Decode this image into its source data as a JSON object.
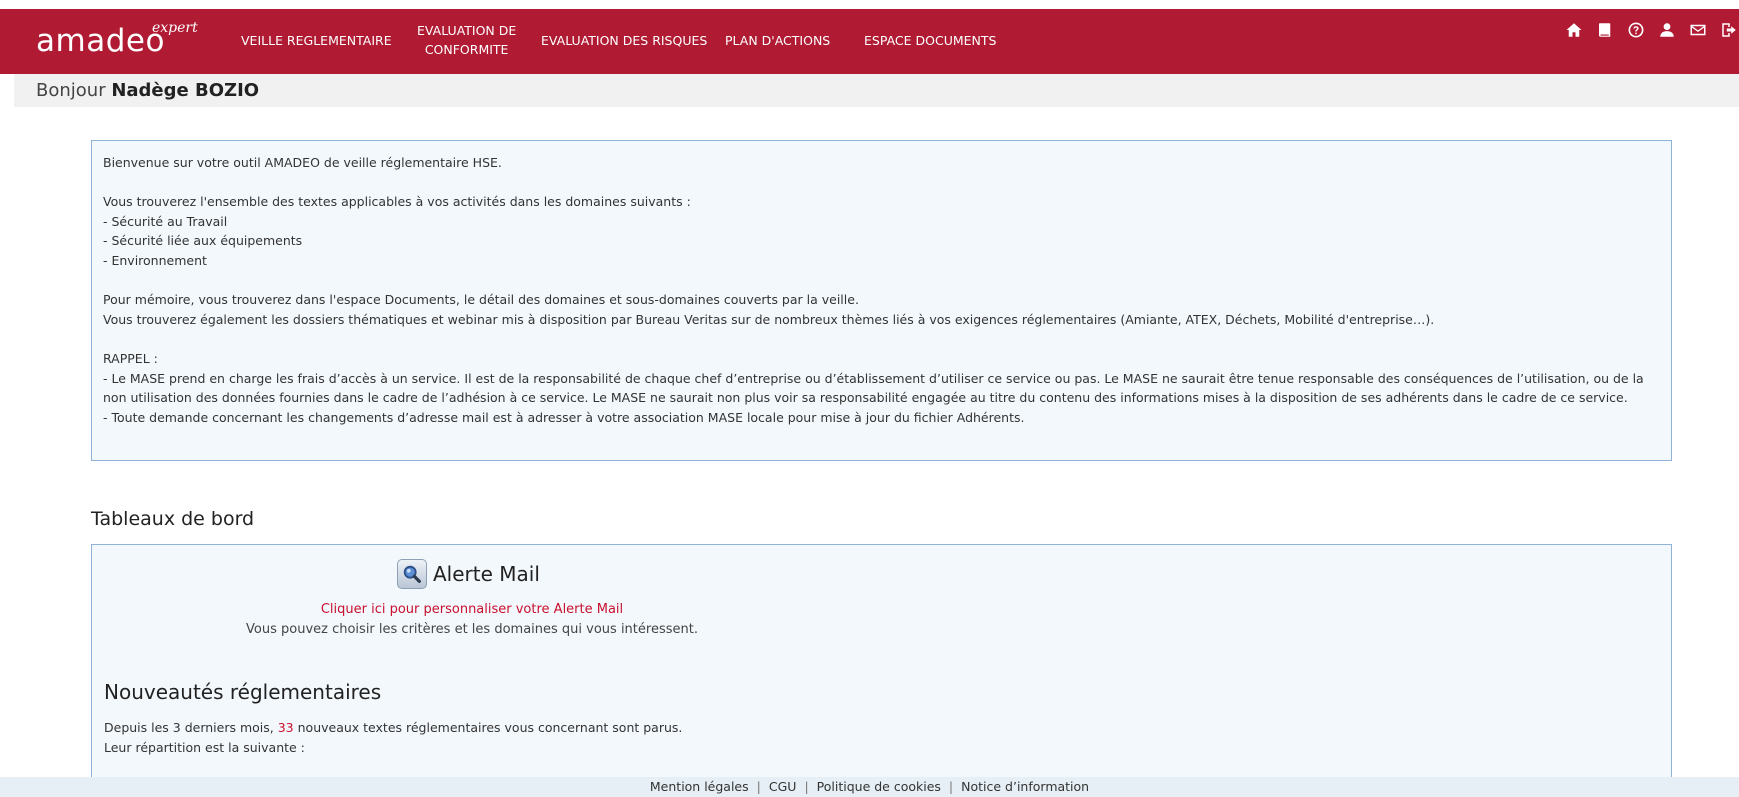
{
  "header": {
    "logo_text": "amadeo",
    "logo_sup": "expert",
    "nav": [
      {
        "label": "VEILLE REGLEMENTAIRE"
      },
      {
        "label_line1": "EVALUATION DE",
        "label_line2": "CONFORMITE"
      },
      {
        "label": "EVALUATION DES RISQUES"
      },
      {
        "label": "PLAN D'ACTIONS"
      },
      {
        "label": "ESPACE DOCUMENTS"
      }
    ],
    "icons": [
      "home-icon",
      "book-icon",
      "help-icon",
      "user-icon",
      "mail-icon",
      "logout-icon"
    ],
    "color": "#b01a33"
  },
  "greeting": {
    "prefix": "Bonjour",
    "name": "Nadège BOZIO"
  },
  "welcome": {
    "lines": [
      "Bienvenue sur votre outil AMADEO de veille réglementaire HSE.",
      "",
      "Vous trouverez l'ensemble des textes applicables à vos activités dans les domaines suivants :",
      "- Sécurité au Travail",
      "- Sécurité liée aux équipements",
      "- Environnement",
      "",
      "Pour mémoire, vous trouverez dans l'espace Documents, le détail des domaines et sous-domaines couverts par la veille.",
      "Vous trouverez également les dossiers thématiques et webinar mis à disposition par Bureau Veritas sur de nombreux thèmes liés à vos exigences réglementaires (Amiante, ATEX, Déchets, Mobilité d'entreprise…).",
      "",
      "RAPPEL :",
      "- Le MASE prend en charge les frais d’accès à un service. Il est de la responsabilité de chaque chef d’entreprise ou d’établissement d’utiliser ce service ou pas. Le MASE ne saurait être tenue responsable des conséquences de l’utilisation, ou de la non utilisation des données fournies dans le cadre de l’adhésion à ce service. Le MASE ne saurait non plus voir sa responsabilité engagée au titre du contenu des informations mises à la disposition de ses adhérents dans le cadre de ce service.",
      "- Toute demande concernant les changements d’adresse mail est à adresser à votre association MASE locale pour mise à jour du fichier Adhérents."
    ]
  },
  "dashboard": {
    "title": "Tableaux de bord",
    "alert_title": "Alerte Mail",
    "alert_link": "Cliquer ici pour personnaliser votre Alerte Mail",
    "alert_sub": "Vous pouvez choisir les critères et les domaines qui vous intéressent.",
    "news_title": "Nouveautés réglementaires",
    "news_prefix": "Depuis les 3 derniers mois,",
    "news_count": "33",
    "news_suffix": "nouveaux textes réglementaires vous concernant sont parus.",
    "news_line2": "Leur répartition est la suivante :"
  },
  "footer": {
    "links": [
      "Mention légales",
      "CGU",
      "Politique de cookies",
      "Notice d’information"
    ]
  }
}
